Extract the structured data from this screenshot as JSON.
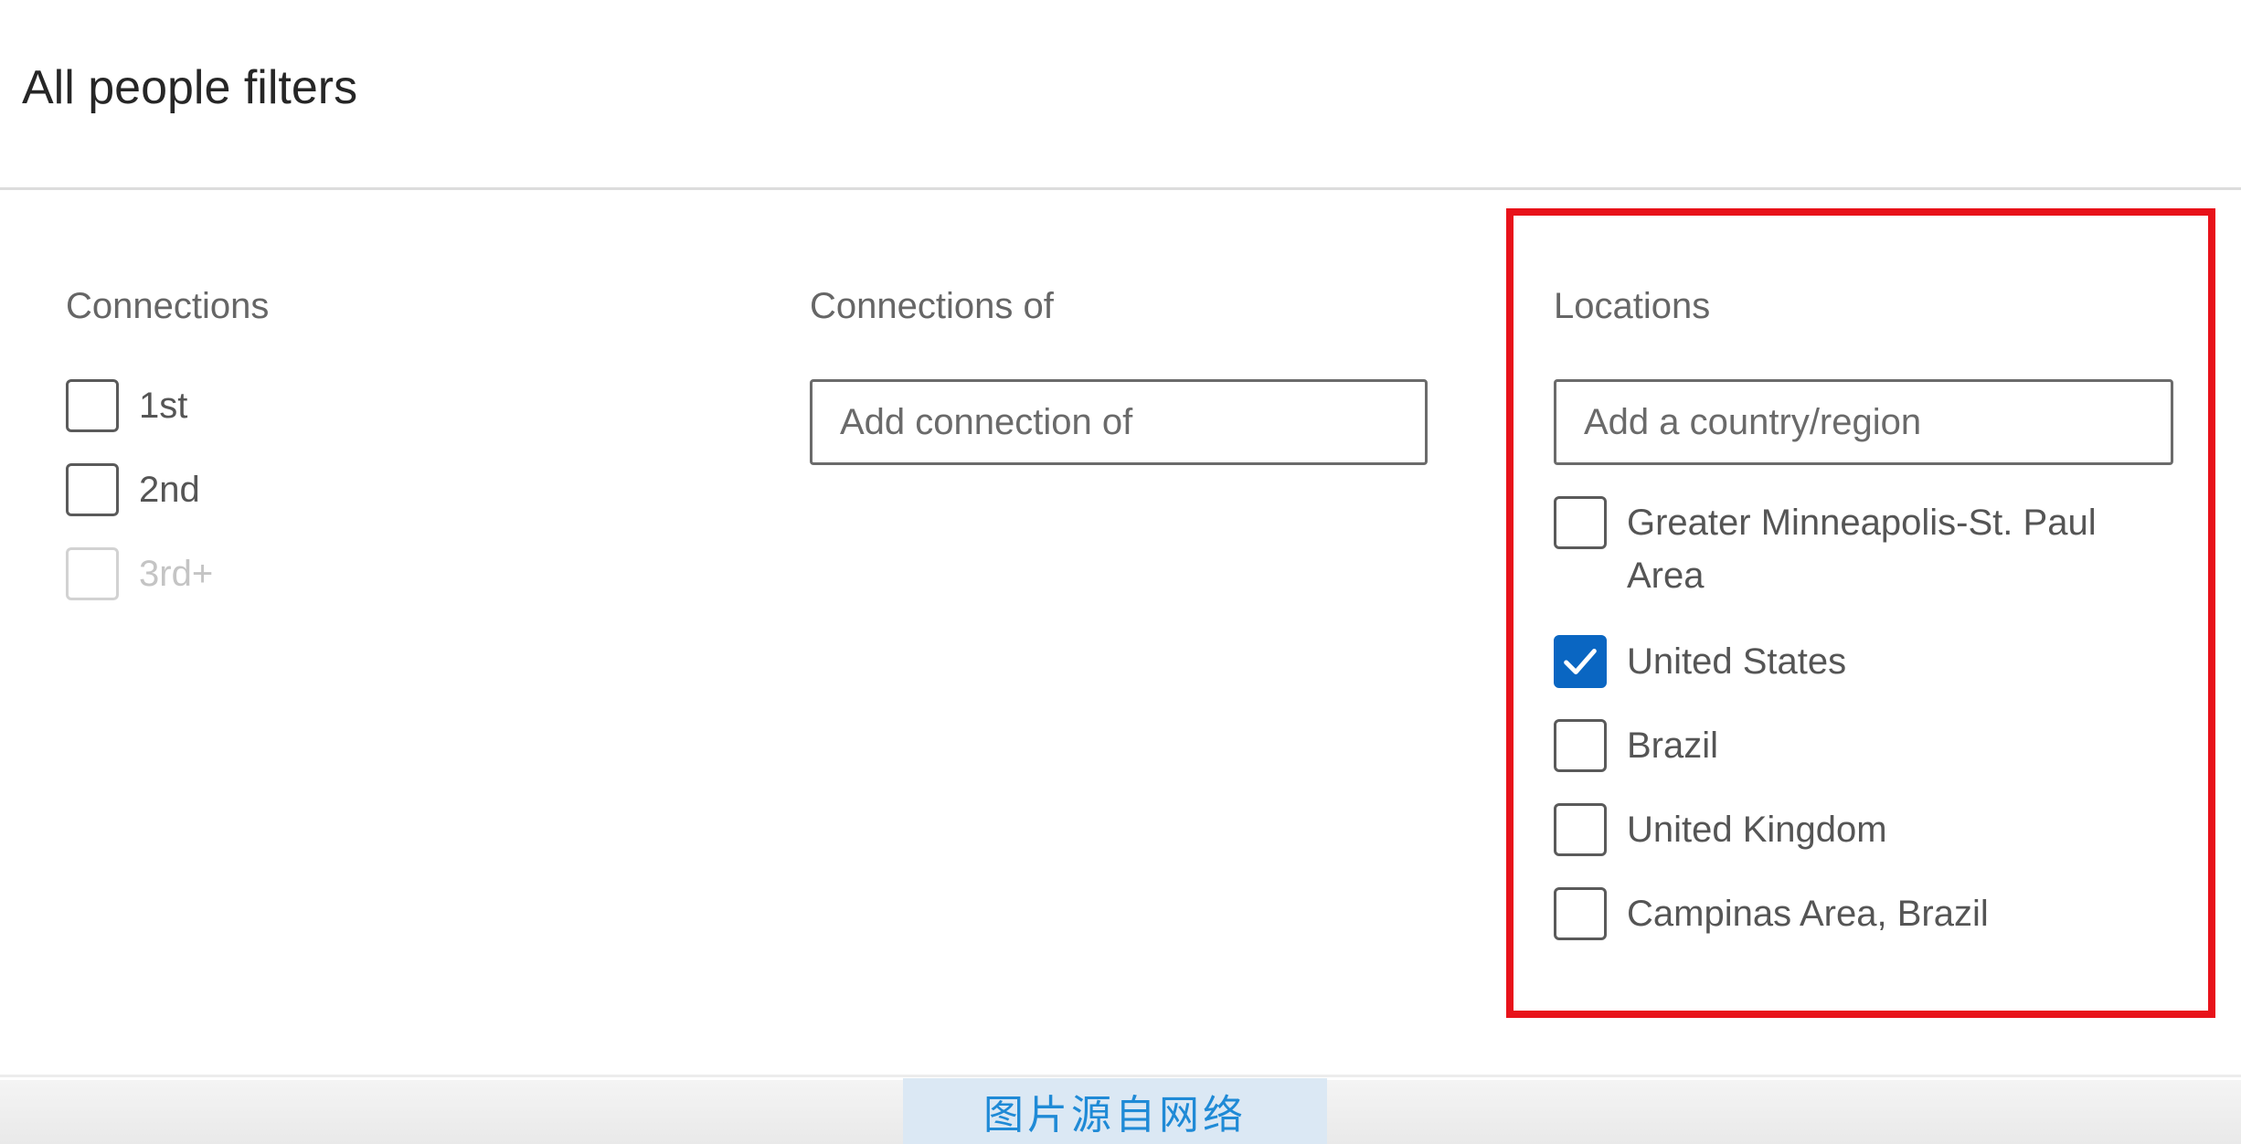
{
  "header": {
    "title": "All people filters"
  },
  "connections": {
    "label": "Connections",
    "options": [
      {
        "label": "1st",
        "checked": false,
        "disabled": false
      },
      {
        "label": "2nd",
        "checked": false,
        "disabled": false
      },
      {
        "label": "3rd+",
        "checked": false,
        "disabled": true
      }
    ]
  },
  "connections_of": {
    "label": "Connections of",
    "input_placeholder": "Add connection of",
    "input_value": ""
  },
  "locations": {
    "label": "Locations",
    "input_placeholder": "Add a country/region",
    "input_value": "",
    "options": [
      {
        "label": "Greater Minneapolis-St. Paul Area",
        "checked": false
      },
      {
        "label": "United States",
        "checked": true
      },
      {
        "label": "Brazil",
        "checked": false
      },
      {
        "label": "United Kingdom",
        "checked": false
      },
      {
        "label": "Campinas Area, Brazil",
        "checked": false
      }
    ]
  },
  "watermark": {
    "text": "图片源自网络"
  },
  "colors": {
    "accent": "#0a66c2",
    "highlight": "#e8121a"
  }
}
